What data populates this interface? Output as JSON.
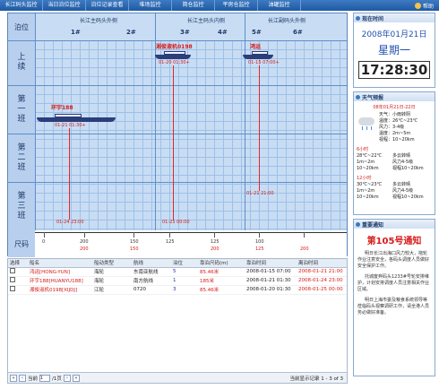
{
  "nav": {
    "tabs": [
      "长江码头监控",
      "当日泊位监控",
      "泊位记录查看",
      "堆场监控",
      "简仓监控",
      "平房仓监控",
      "油罐监控"
    ],
    "help": "帮助"
  },
  "berth": {
    "corner": "泊位",
    "sections": [
      "长江主码头外侧",
      "长江主码头内侧",
      "长江副码头外侧"
    ],
    "berth_nums": [
      "1#",
      "2#",
      "3#",
      "4#",
      "5#",
      "6#"
    ],
    "rows": [
      {
        "lines": [
          "上",
          "续"
        ]
      },
      {
        "lines": [
          "第",
          "一",
          "班"
        ]
      },
      {
        "lines": [
          "第",
          "二",
          "班"
        ]
      },
      {
        "lines": [
          "第",
          "三",
          "班"
        ]
      }
    ],
    "ruler_label": "尺码",
    "vessels": [
      {
        "name": "环宇188",
        "time": "01-21 01:30+"
      },
      {
        "name": "湘俊淑机0198",
        "time": "01-20 01:30+"
      },
      {
        "name": "鸿运",
        "time": "01-15 07:00+"
      }
    ],
    "end_times": [
      "01-24 23:00",
      "01-25 00:00",
      "01-21 21:00"
    ],
    "ruler_ticks": [
      "0",
      "200",
      "150",
      "125",
      "0",
      "125",
      "0",
      "100",
      "0",
      "0",
      "00",
      "00"
    ],
    "ruler_ticks2": [
      "200",
      "150",
      "200",
      "125",
      "200"
    ]
  },
  "table": {
    "headers": [
      "选择",
      "船名",
      "船动类型",
      "航线",
      "泊位",
      "靠泊尺码(m)",
      "靠泊时间",
      "离泊时间"
    ],
    "rows": [
      {
        "name": "鸿运[HONG-YUN]",
        "type": "海轮",
        "route": "东南亚航线",
        "berth": "5",
        "size": "85.46米",
        "arrive": "2008-01-15 07:00",
        "leave": "2008-01-21 21:00"
      },
      {
        "name": "环宇188[HUANYU188]",
        "type": "海轮",
        "route": "南方航线",
        "berth": "1",
        "size": "185米",
        "arrive": "2008-01-21 01:30",
        "leave": "2008-01-24 23:00"
      },
      {
        "name": "湘俊淑机0198[XIJDJ]",
        "type": "江轮",
        "route": "0720",
        "berth": "3",
        "size": "85.46米",
        "arrive": "2008-01-20 01:30",
        "leave": "2008-01-25 00:00"
      }
    ],
    "pager": {
      "label_prefix": "当前",
      "page": "1",
      "label_suffix": "/1页",
      "summary": "当前显示记录 1 - 3 of 3"
    }
  },
  "clock": {
    "title": "现在时间",
    "date": "2008年01月21日",
    "weekday": "星期一",
    "time": "17:28:30"
  },
  "weather": {
    "title": "天气预报",
    "date_range": "08年01月21日-22日",
    "today": [
      "天气：小雨转阴",
      "温度：26℃~23℃",
      "风力：3-4级",
      "温度：2m~5m",
      "视程：10~20km"
    ],
    "forecast": [
      {
        "label": "6小时",
        "left": [
          "28℃~22℃",
          "1m~2m",
          "10~20km"
        ],
        "right": [
          "多云转晴",
          "风力4-5级",
          "视程10~20km"
        ]
      },
      {
        "label": "12小时",
        "left": [
          "30℃~23℃",
          "1m~2m",
          "10~20km"
        ],
        "right": [
          "多云转晴",
          "风力4-5级",
          "视程10~20km"
        ]
      }
    ]
  },
  "notice": {
    "title": "重要通知",
    "heading": "第105号通知",
    "paragraphs": [
      "明日长江出海口风力较大，拖轮作业注意安全，各码头调度人员做好安全保护工作。",
      "托城废弃码头1233#号轮安排维护，计划安排调度人员注意相关作业区域。",
      "明日上海市委及粮食系统领导等莅临码头视察调研工作，请全港人员务必做好准备。"
    ]
  }
}
